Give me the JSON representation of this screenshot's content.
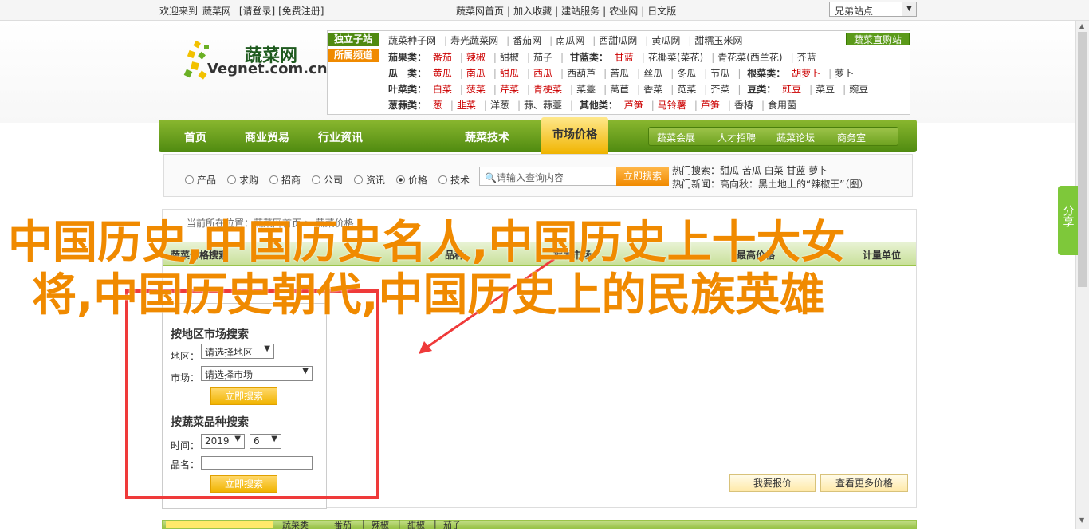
{
  "topbar": {
    "welcome": "欢迎来到",
    "site": "蔬菜网",
    "login": "[请登录]",
    "register": "[免费注册]",
    "links": [
      "蔬菜网首页",
      "|",
      "加入收藏",
      "|",
      "建站服务",
      "|",
      "农业网",
      "|",
      "日文版"
    ],
    "region_select": "兄弟站点"
  },
  "logo": {
    "cn": "蔬菜网",
    "en": "Vegnet.com.cn"
  },
  "categories": {
    "tag_standalone": "独立子站",
    "tag_featured": "所属频道",
    "direct": "蔬菜直购站",
    "substations": [
      "蔬菜种子网",
      "寿光蔬菜网",
      "番茄网",
      "南瓜网",
      "西甜瓜网",
      "黄瓜网",
      "甜糯玉米网"
    ],
    "rows": [
      {
        "label": "茄果类：",
        "items": [
          "番茄",
          "辣椒",
          "甜椒",
          "茄子"
        ],
        "label2": "甘蓝类：",
        "items2": [
          "甘蓝",
          "花椰菜(菜花)",
          "青花菜(西兰花)",
          "芥蓝"
        ]
      },
      {
        "label": "瓜　类：",
        "items": [
          "黄瓜",
          "南瓜",
          "甜瓜",
          "西瓜",
          "西葫芦",
          "苦瓜",
          "丝瓜",
          "冬瓜",
          "节瓜"
        ],
        "label2": "根菜类：",
        "items2": [
          "胡萝卜",
          "萝卜"
        ]
      },
      {
        "label": "叶菜类：",
        "items": [
          "白菜",
          "菠菜",
          "芹菜",
          "青梗菜",
          "菜薹",
          "莴苣",
          "香菜",
          "苋菜",
          "芥菜"
        ],
        "label2": "豆类：",
        "items2": [
          "豇豆",
          "菜豆",
          "豌豆"
        ]
      },
      {
        "label": "葱蒜类：",
        "items": [
          "葱",
          "韭菜",
          "洋葱",
          "蒜、蒜薹"
        ],
        "label2": "其他类：",
        "items2": [
          "芦笋",
          "马铃薯",
          "芦笋",
          "香椿",
          "食用菌"
        ]
      }
    ]
  },
  "nav": {
    "items": [
      "首页",
      "商业贸易",
      "行业资讯",
      "市场价格",
      "蔬菜技术"
    ],
    "sub": [
      "蔬菜会展",
      "人才招聘",
      "蔬菜论坛",
      "商务室"
    ]
  },
  "search": {
    "options": [
      "产品",
      "求购",
      "招商",
      "公司",
      "资讯",
      "价格",
      "技术"
    ],
    "placeholder": "请输入查询内容",
    "button": "立即搜索",
    "hot_label": "热门搜索：",
    "hot_items": "甜瓜  苦瓜  白菜  甘蓝  萝卜",
    "news_label": "热门新闻：",
    "news_item": "高向秋：黑土地上的“辣椒王”（图）"
  },
  "content": {
    "crumb": "当前所在位置：蔬菜网首页 > 蔬菜价格",
    "tabs": [
      "蔬菜价格搜索",
      "品种",
      "批发市场",
      "最高价格",
      "计量单位"
    ],
    "side_title1": "按地区市场搜索",
    "area_label": "地区：",
    "area_value": "请选择地区",
    "market_label": "市场：",
    "market_value": "请选择市场",
    "btn1": "立即搜索",
    "side_title2": "按蔬菜品种搜索",
    "time_label": "时间：",
    "year": "2019",
    "month": "6",
    "name_label": "品名：",
    "btn2": "立即搜索",
    "btn_report": "我要报价",
    "btn_more": "查看更多价格"
  },
  "overlay_title": {
    "line1": "中国历史,中国历史名人,中国历史上十大女",
    "line2": "将,中国历史朝代,中国历史上的民族英雄"
  },
  "share": "分享",
  "bottom": {
    "label": "蔬菜类",
    "items": [
      "番茄",
      "|",
      "辣椒",
      "|",
      "甜椒",
      "|",
      "茄子"
    ]
  }
}
